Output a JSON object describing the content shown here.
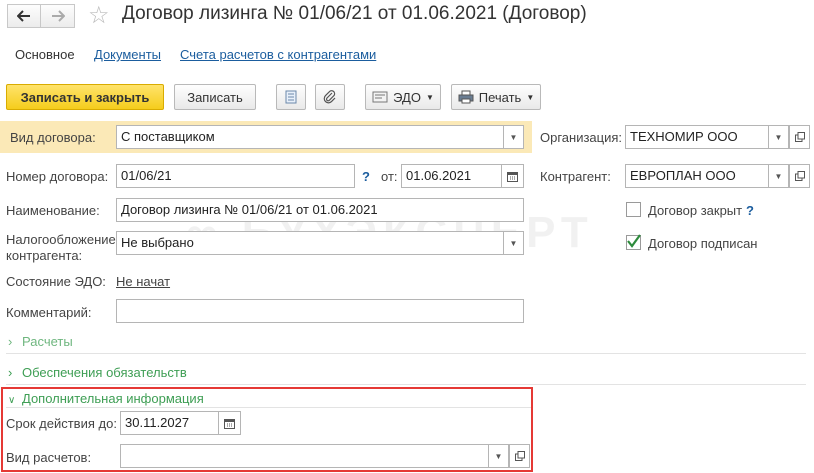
{
  "window": {
    "title": "Договор лизинга № 01/06/21 от 01.06.2021 (Договор)"
  },
  "tabs": [
    {
      "label": "Основное"
    },
    {
      "label": "Документы"
    },
    {
      "label": "Счета расчетов с контрагентами"
    }
  ],
  "toolbar": {
    "save_close": "Записать и закрыть",
    "save": "Записать",
    "edo": "ЭДО",
    "print": "Печать"
  },
  "form": {
    "contract_type": {
      "label": "Вид договора:",
      "value": "С поставщиком"
    },
    "number": {
      "label": "Номер договора:",
      "value": "01/06/21",
      "help": "?",
      "date_label": "от:",
      "date": "01.06.2021"
    },
    "name": {
      "label": "Наименование:",
      "value": "Договор лизинга № 01/06/21 от 01.06.2021"
    },
    "tax": {
      "label_line1": "Налогообложение",
      "label_line2": "контрагента:",
      "value": "Не выбрано"
    },
    "edo_state": {
      "label": "Состояние ЭДО:",
      "value": "Не начат"
    },
    "comment": {
      "label": "Комментарий:",
      "value": ""
    },
    "organization": {
      "label": "Организация:",
      "value": "ТЕХНОМИР ООО"
    },
    "counterparty": {
      "label": "Контрагент:",
      "value": "ЕВРОПЛАН ООО"
    },
    "closed": {
      "label": "Договор закрыт",
      "help": "?",
      "checked": false
    },
    "signed": {
      "label": "Договор подписан",
      "checked": true
    }
  },
  "sections": {
    "payments": "Расчеты",
    "collateral": "Обеспечения обязательств",
    "additional": "Дополнительная информация"
  },
  "additional": {
    "valid_until": {
      "label": "Срок действия до:",
      "value": "30.11.2027"
    },
    "payment_type": {
      "label": "Вид расчетов:",
      "value": ""
    }
  },
  "watermark": "БУХЭКСПЕРТ",
  "colors": {
    "accent_yellow": "#f5cd1c",
    "link_blue": "#1b5d9e",
    "section_green": "#3e9e54",
    "highlight_red": "#e53935",
    "row_highlight": "#fbe9b7"
  }
}
